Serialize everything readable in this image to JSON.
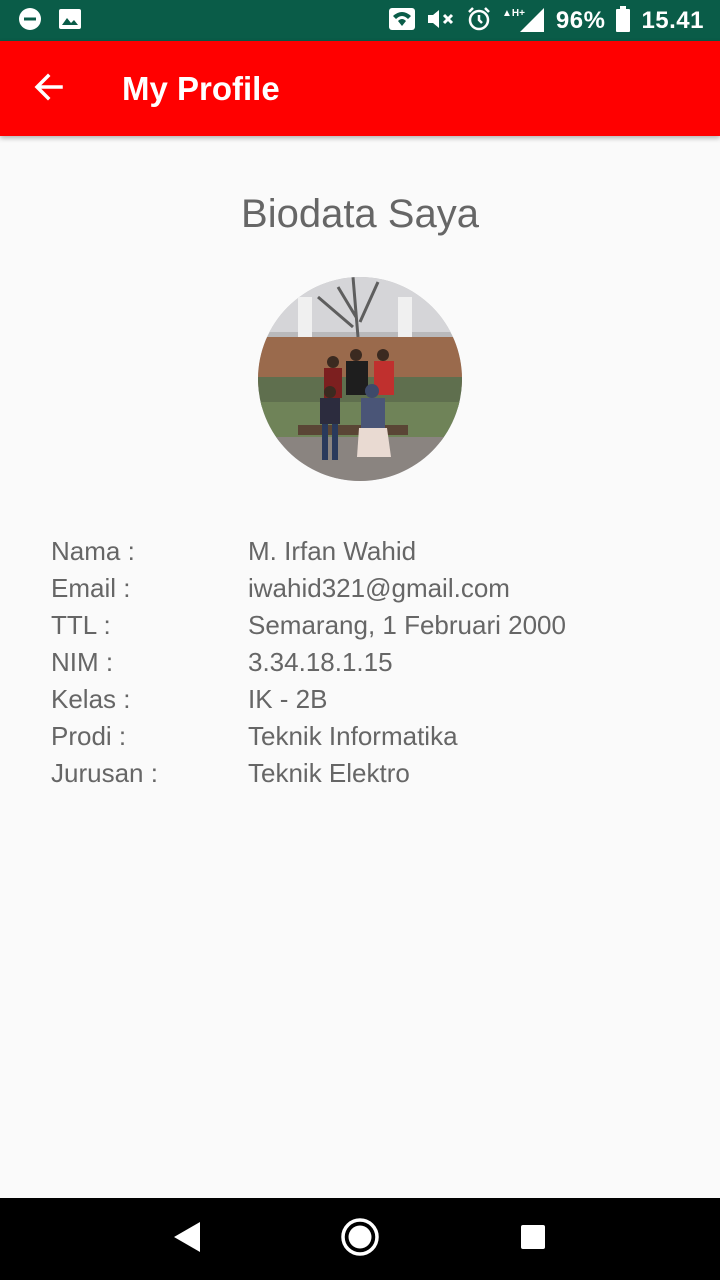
{
  "status_bar": {
    "battery": "96%",
    "time": "15.41",
    "icons": [
      "do-not-disturb-icon",
      "image-icon",
      "wifi-icon",
      "mute-icon",
      "alarm-icon",
      "signal-icon",
      "battery-icon"
    ]
  },
  "app_bar": {
    "title": "My Profile",
    "back_icon": "arrow-back-icon",
    "color": "#ff0000"
  },
  "profile": {
    "heading": "Biodata Saya",
    "photo": "group-photo",
    "fields": [
      {
        "label": "Nama :",
        "value": "M. Irfan Wahid"
      },
      {
        "label": "Email :",
        "value": "iwahid321@gmail.com"
      },
      {
        "label": "TTL :",
        "value": "Semarang, 1 Februari 2000"
      },
      {
        "label": "NIM :",
        "value": "3.34.18.1.15"
      },
      {
        "label": "Kelas :",
        "value": "IK - 2B"
      },
      {
        "label": "Prodi :",
        "value": "Teknik Informatika"
      },
      {
        "label": "Jurusan :",
        "value": "Teknik Elektro"
      }
    ]
  },
  "nav_bar": {
    "icons": [
      "back-triangle-icon",
      "home-circle-icon",
      "recents-square-icon"
    ]
  }
}
